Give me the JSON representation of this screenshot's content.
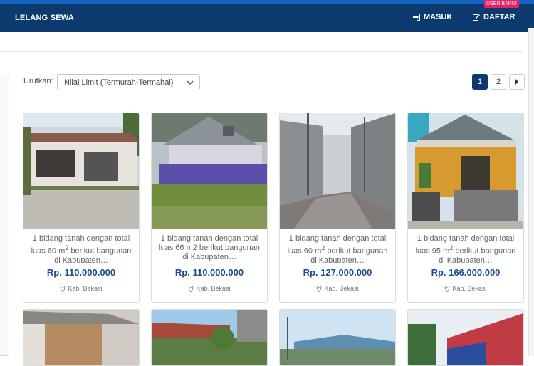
{
  "nav": {
    "brand": "LELANG SEWA",
    "login_label": "MASUK",
    "register_label": "DAFTAR",
    "new_user_badge": "USER BARU!"
  },
  "sort": {
    "label": "Urutkan:",
    "selected": "Nilai Limit (Termurah-Termahal)"
  },
  "pagination": {
    "pages": [
      "1",
      "2"
    ],
    "current": "1"
  },
  "listings": [
    {
      "title_a": "1 bidang tanah dengan total luas 60 m",
      "sup": "2",
      "title_b": " berikut bangunan di Kabupaten…",
      "price": "Rp. 110.000.000",
      "location": "Kab. Bekasi"
    },
    {
      "title_a": "1 bidang tanah dengan total luas 66 m2 berikut bangunan di Kabupaten…",
      "sup": "",
      "title_b": "",
      "price": "Rp. 110.000.000",
      "location": "Kab. Bekasi"
    },
    {
      "title_a": "1 bidang tanah dengan total luas 60 m",
      "sup": "2",
      "title_b": " berikut bangunan di Kabupaten…",
      "price": "Rp. 127.000.000",
      "location": "Kab. Bekasi"
    },
    {
      "title_a": "1 bidang tanah dengan total luas 95 m",
      "sup": "2",
      "title_b": " berikut bangunan di Kabupaten…",
      "price": "Rp. 166.000.000",
      "location": "Kab. Bekasi"
    }
  ],
  "colors": {
    "navbar": "#0c3a6e",
    "accent": "#1565c0",
    "price": "#1a4f8b",
    "badge": "#e91e63"
  },
  "icons": [
    "sign-in-icon",
    "edit-icon",
    "chevron-down-icon",
    "chevron-right-icon",
    "map-marker-icon"
  ]
}
